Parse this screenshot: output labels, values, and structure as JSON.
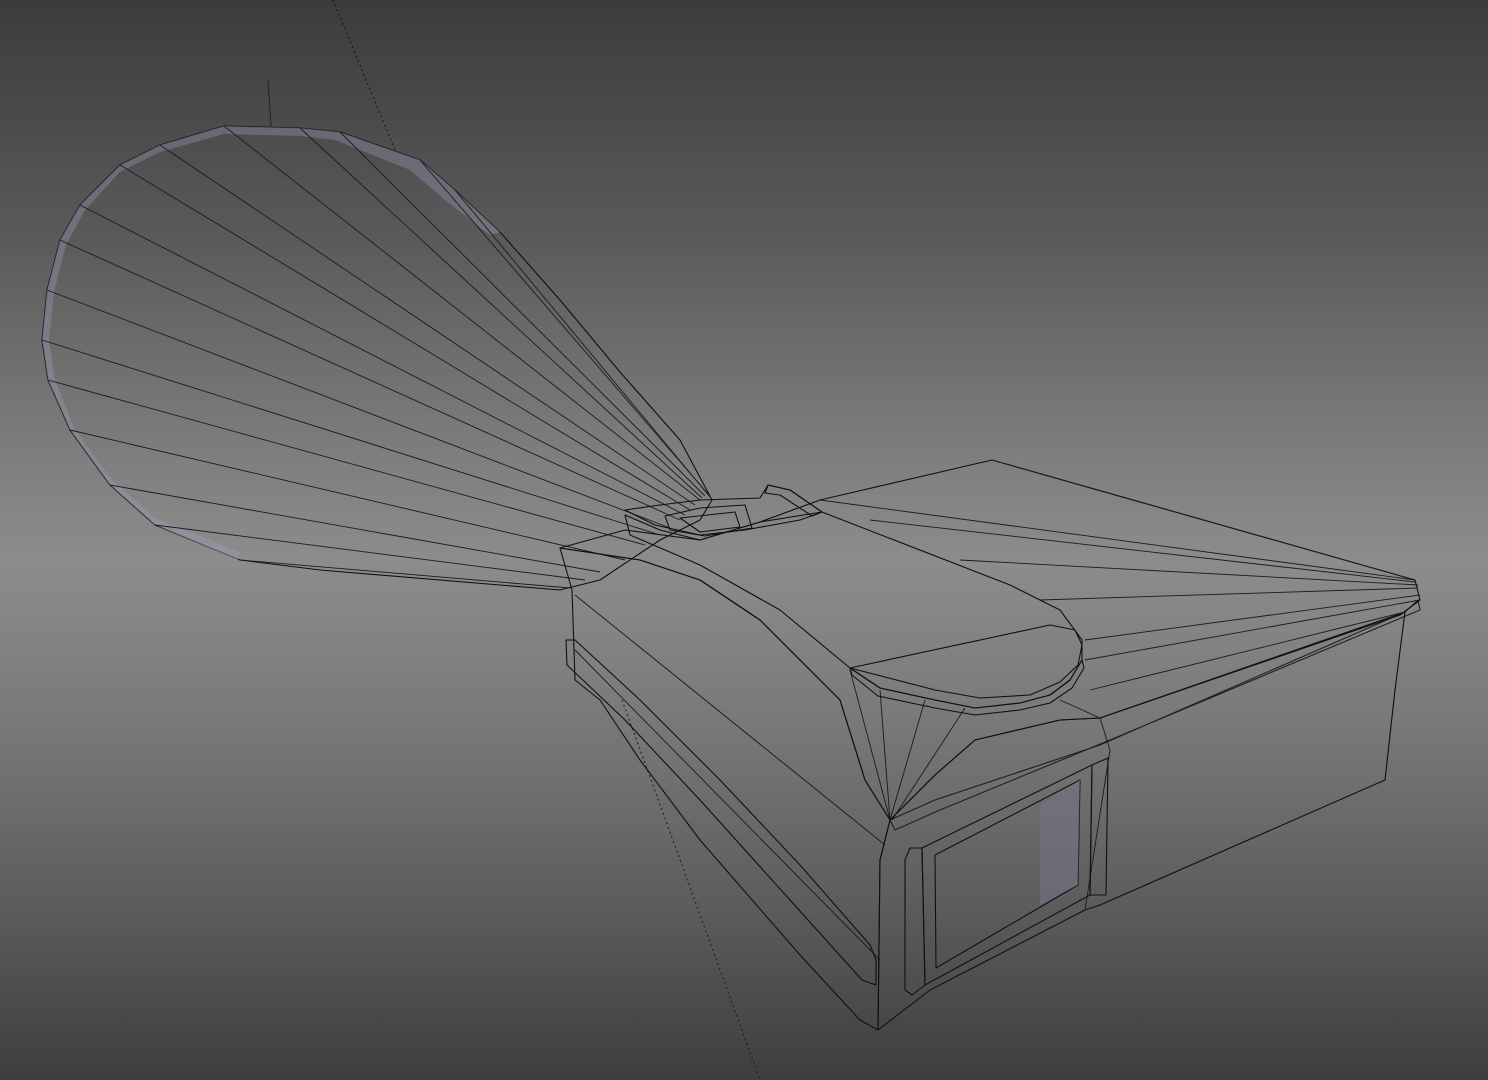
{
  "viewport": {
    "name": "3D Viewport",
    "shading": "solid",
    "overlay": "wireframe-edges",
    "background_top": "#3c3c3c",
    "background_mid": "#8c8c8c",
    "background_bottom": "#3e3e3e"
  },
  "object": {
    "description_icon": "mesh-object-icon",
    "parts": [
      "bell-horn",
      "neck-bracket",
      "main-block",
      "front-opening"
    ]
  },
  "colors": {
    "mesh_light": "#b4b6c2",
    "mesh_mid": "#8d8f9e",
    "mesh_dark": "#5a5c6a",
    "edge": "#101014"
  },
  "guides": {
    "dotted_axis": "camera-guide-line"
  }
}
